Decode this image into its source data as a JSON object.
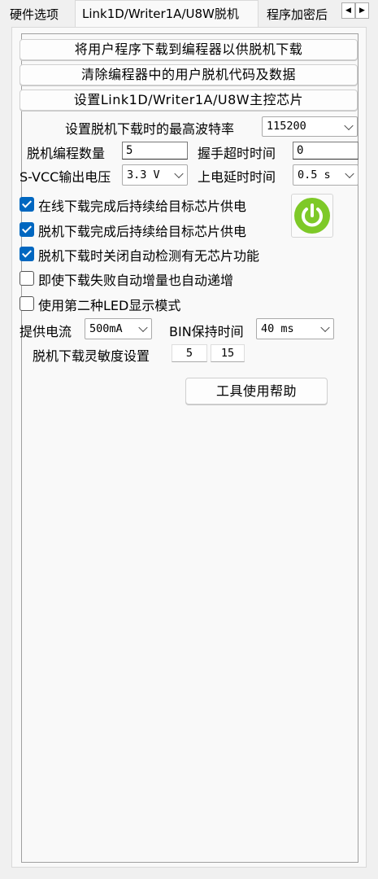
{
  "tabs": [
    {
      "label": "硬件选项"
    },
    {
      "label": "Link1D/Writer1A/U8W脱机"
    },
    {
      "label": "程序加密后"
    }
  ],
  "buttons": {
    "download": "将用户程序下载到编程器以供脱机下载",
    "clear": "清除编程器中的用户脱机代码及数据",
    "set_master": "设置Link1D/Writer1A/U8W主控芯片",
    "help": "工具使用帮助"
  },
  "fields": {
    "baud_label": "设置脱机下载时的最高波特率",
    "baud_value": "115200",
    "count_label": "脱机编程数量",
    "count_value": "5",
    "handshake_label": "握手超时时间",
    "handshake_value": "0",
    "vcc_label": "S-VCC输出电压",
    "vcc_value": "3.3 V",
    "delay_label": "上电延时时间",
    "delay_value": "0.5 s",
    "current_label": "提供电流",
    "current_value": "500mA",
    "bin_label": "BIN保持时间",
    "bin_value": "40 ms",
    "sens_label": "脱机下载灵敏度设置",
    "sens_a": "5",
    "sens_b": "15"
  },
  "checkboxes": [
    {
      "label": "在线下载完成后持续给目标芯片供电",
      "checked": true
    },
    {
      "label": "脱机下载完成后持续给目标芯片供电",
      "checked": true
    },
    {
      "label": "脱机下载时关闭自动检测有无芯片功能",
      "checked": true
    },
    {
      "label": "即使下载失败自动增量也自动递增",
      "checked": false
    },
    {
      "label": "使用第二种LED显示模式",
      "checked": false
    }
  ],
  "icons": {
    "power": "power-icon",
    "tab_left": "scroll-left-icon",
    "tab_right": "scroll-right-icon"
  },
  "colors": {
    "power_green": "#7ec928",
    "checkbox_blue": "#0067c0"
  }
}
